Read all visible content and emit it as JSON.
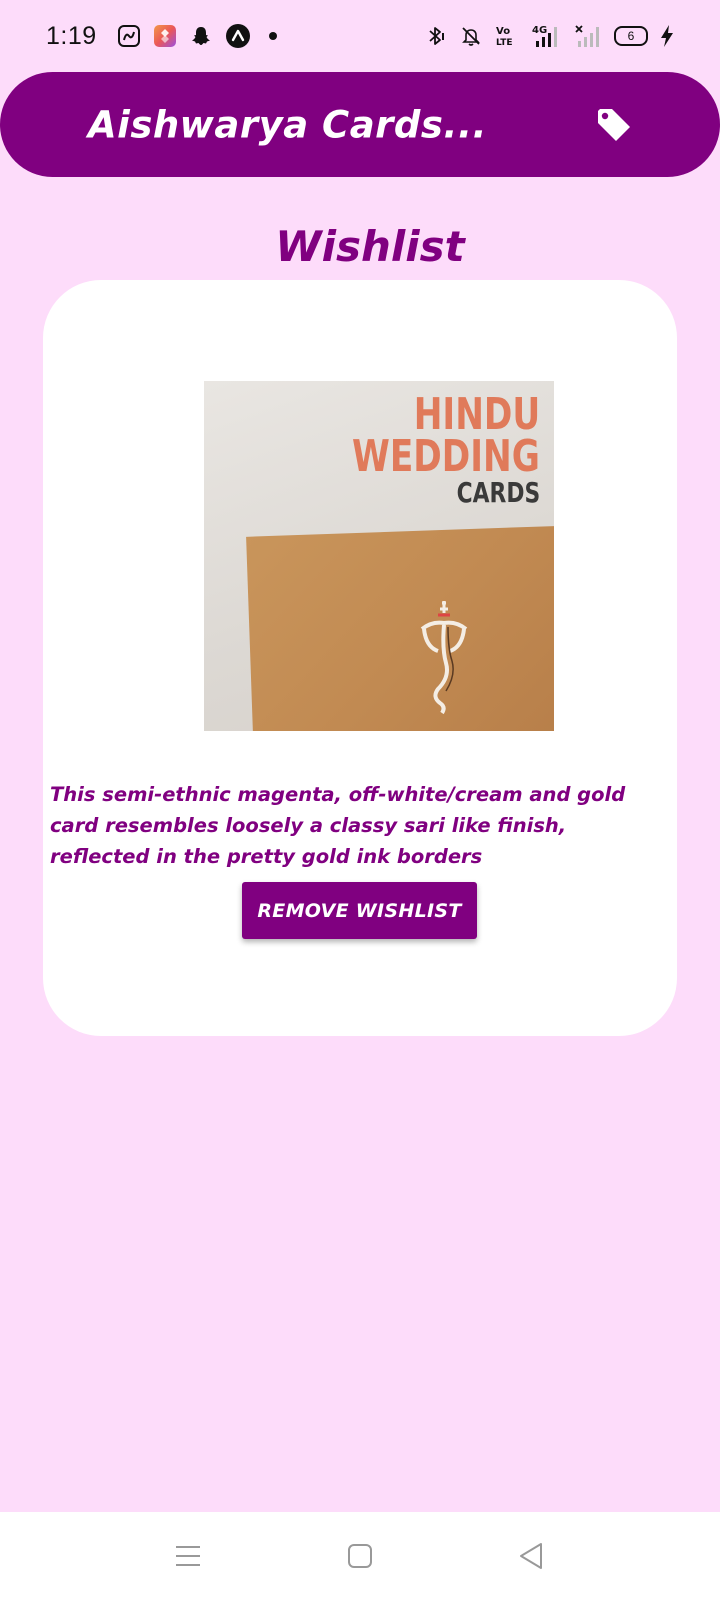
{
  "status_bar": {
    "time": "1:19",
    "battery_level": "6",
    "left_icons": [
      "jiosaavn-icon",
      "shortcut-app-icon",
      "snapchat-icon",
      "arrow-app-icon",
      "notification-dot"
    ],
    "right_icons": [
      "bluetooth-icon",
      "mute-icon",
      "volte-icon",
      "signal-4g-icon",
      "signal-no-service-icon",
      "battery-icon",
      "charging-icon"
    ],
    "volte_label": "Vo LTE",
    "network_label": "4G"
  },
  "header": {
    "title": "Aishwarya Cards...",
    "tag_icon": "tag-icon"
  },
  "page": {
    "title": "Wishlist"
  },
  "card": {
    "image_text_line1": "HINDU",
    "image_text_line2": "WEDDING",
    "image_text_line3": "CARDS",
    "description": "This semi-ethnic magenta, off-white/cream and gold card resembles loosely a classy sari like finish, reflected in the pretty gold ink borders",
    "button_label": "REMOVE WISHLIST"
  },
  "nav_bar": {
    "items": [
      "menu-icon",
      "home-icon",
      "back-icon"
    ]
  },
  "colors": {
    "primary": "#800080",
    "background": "#FDDCFA",
    "card": "#FFFFFF"
  }
}
